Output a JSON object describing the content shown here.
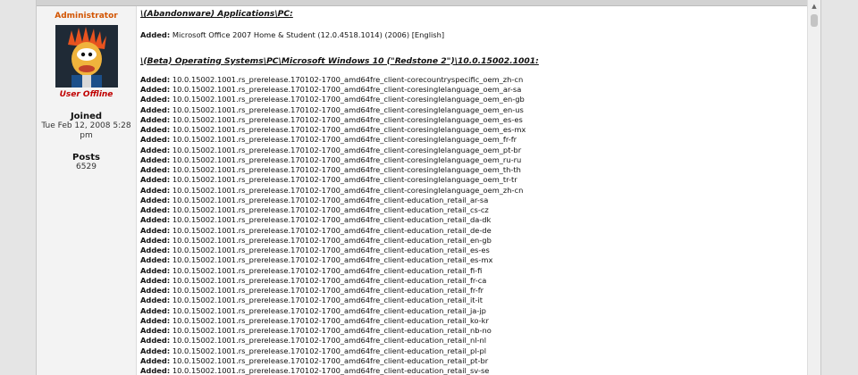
{
  "user": {
    "rank": "Administrator",
    "status": "User Offline",
    "joined_label": "Joined",
    "joined_value": "Tue Feb 12, 2008 5:28 pm",
    "posts_label": "Posts",
    "posts_value": "6529"
  },
  "post": {
    "section1_heading": "\\(Abandonware) Applications\\PC:",
    "section1_added_label": "Added:",
    "section1_added_value": "Microsoft Office 2007 Home & Student (12.0.4518.1014) (2006) [English]",
    "section2_heading": "\\(Beta) Operating Systems\\PC\\Microsoft Windows 10 (\"Redstone 2\")\\10.0.15002.1001:",
    "added_label": "Added:",
    "items": [
      "10.0.15002.1001.rs_prerelease.170102-1700_amd64fre_client-corecountryspecific_oem_zh-cn",
      "10.0.15002.1001.rs_prerelease.170102-1700_amd64fre_client-coresinglelanguage_oem_ar-sa",
      "10.0.15002.1001.rs_prerelease.170102-1700_amd64fre_client-coresinglelanguage_oem_en-gb",
      "10.0.15002.1001.rs_prerelease.170102-1700_amd64fre_client-coresinglelanguage_oem_en-us",
      "10.0.15002.1001.rs_prerelease.170102-1700_amd64fre_client-coresinglelanguage_oem_es-es",
      "10.0.15002.1001.rs_prerelease.170102-1700_amd64fre_client-coresinglelanguage_oem_es-mx",
      "10.0.15002.1001.rs_prerelease.170102-1700_amd64fre_client-coresinglelanguage_oem_fr-fr",
      "10.0.15002.1001.rs_prerelease.170102-1700_amd64fre_client-coresinglelanguage_oem_pt-br",
      "10.0.15002.1001.rs_prerelease.170102-1700_amd64fre_client-coresinglelanguage_oem_ru-ru",
      "10.0.15002.1001.rs_prerelease.170102-1700_amd64fre_client-coresinglelanguage_oem_th-th",
      "10.0.15002.1001.rs_prerelease.170102-1700_amd64fre_client-coresinglelanguage_oem_tr-tr",
      "10.0.15002.1001.rs_prerelease.170102-1700_amd64fre_client-coresinglelanguage_oem_zh-cn",
      "10.0.15002.1001.rs_prerelease.170102-1700_amd64fre_client-education_retail_ar-sa",
      "10.0.15002.1001.rs_prerelease.170102-1700_amd64fre_client-education_retail_cs-cz",
      "10.0.15002.1001.rs_prerelease.170102-1700_amd64fre_client-education_retail_da-dk",
      "10.0.15002.1001.rs_prerelease.170102-1700_amd64fre_client-education_retail_de-de",
      "10.0.15002.1001.rs_prerelease.170102-1700_amd64fre_client-education_retail_en-gb",
      "10.0.15002.1001.rs_prerelease.170102-1700_amd64fre_client-education_retail_es-es",
      "10.0.15002.1001.rs_prerelease.170102-1700_amd64fre_client-education_retail_es-mx",
      "10.0.15002.1001.rs_prerelease.170102-1700_amd64fre_client-education_retail_fi-fi",
      "10.0.15002.1001.rs_prerelease.170102-1700_amd64fre_client-education_retail_fr-ca",
      "10.0.15002.1001.rs_prerelease.170102-1700_amd64fre_client-education_retail_fr-fr",
      "10.0.15002.1001.rs_prerelease.170102-1700_amd64fre_client-education_retail_it-it",
      "10.0.15002.1001.rs_prerelease.170102-1700_amd64fre_client-education_retail_ja-jp",
      "10.0.15002.1001.rs_prerelease.170102-1700_amd64fre_client-education_retail_ko-kr",
      "10.0.15002.1001.rs_prerelease.170102-1700_amd64fre_client-education_retail_nb-no",
      "10.0.15002.1001.rs_prerelease.170102-1700_amd64fre_client-education_retail_nl-nl",
      "10.0.15002.1001.rs_prerelease.170102-1700_amd64fre_client-education_retail_pl-pl",
      "10.0.15002.1001.rs_prerelease.170102-1700_amd64fre_client-education_retail_pt-br",
      "10.0.15002.1001.rs_prerelease.170102-1700_amd64fre_client-education_retail_sv-se"
    ]
  },
  "colors": {
    "rank": "#d25400",
    "status": "#c00000",
    "sidebar_bg": "#f3f3f3"
  },
  "icons": {
    "avatar": "muppet-avatar",
    "scroll_up": "arrow-up-icon"
  }
}
